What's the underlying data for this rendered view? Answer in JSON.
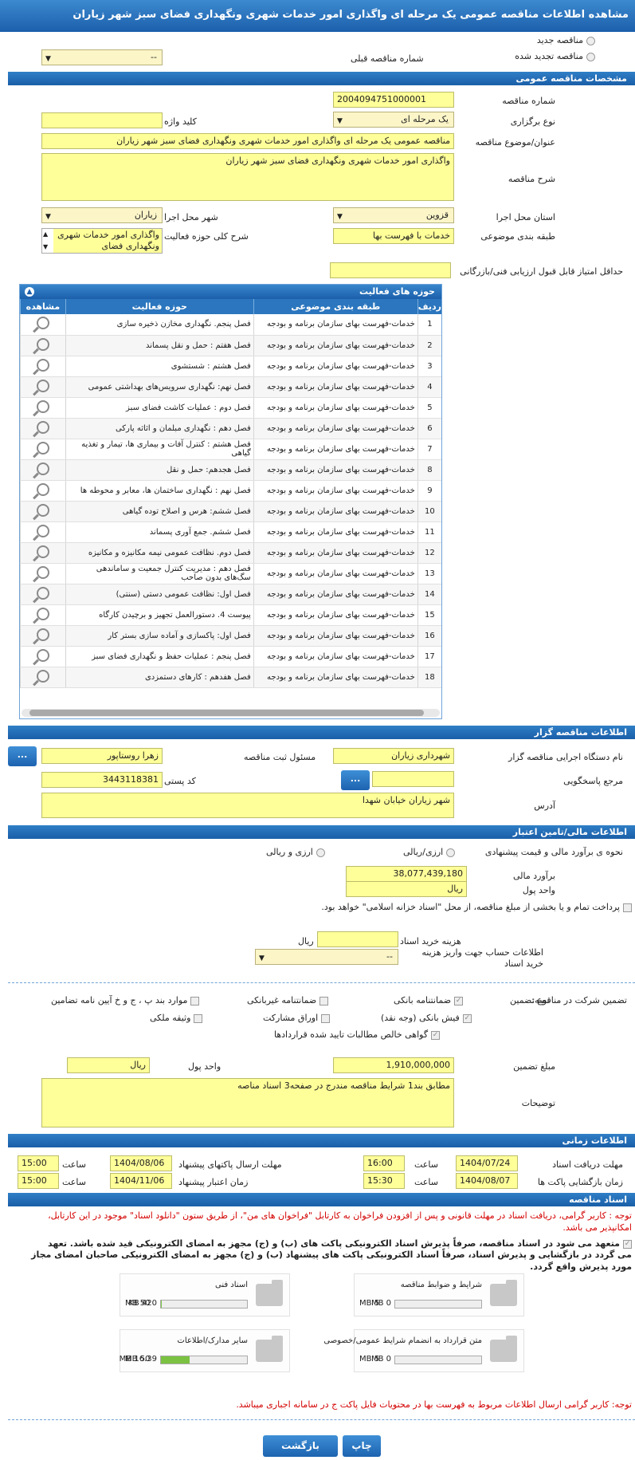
{
  "header": {
    "title": "مشاهده اطلاعات مناقصه عمومی یک مرحله ای واگذاری امور خدمات شهری ونگهداری فضای سبز شهر زیاران"
  },
  "top": {
    "new_tender": "مناقصه جدید",
    "renewed_tender": "مناقصه تجدید شده",
    "prev_number_label": "شماره مناقصه قبلی",
    "prev_number_value": "--"
  },
  "general": {
    "title": "مشخصات مناقصه عمومی",
    "number_label": "شماره مناقصه",
    "number_value": "2004094751000001",
    "type_label": "نوع برگزاری",
    "type_value": "یک مرحله ای",
    "keyword_label": "کلید واژه",
    "subject_label": "عنوان/موضوع مناقصه",
    "subject_value": "مناقصه عمومی یک مرحله ای واگذاری امور خدمات شهری ونگهداری فضای سبز شهر زیاران",
    "desc_label": "شرح مناقصه",
    "desc_value": "واگذاری امور خدمات شهری ونگهداری فضای سبز شهر زیاران",
    "province_label": "استان محل اجرا",
    "province_value": "قزوین",
    "city_label": "شهر محل اجرا",
    "city_value": "زیاران",
    "category_label": "طبقه بندی موضوعی",
    "category_value": "خدمات با فهرست بها",
    "activity_label": "شرح کلی حوزه فعالیت",
    "activity_value": "واگذاری امور خدمات شهری ونگهداری فضای",
    "min_score_label": "حداقل امتیاز قابل قبول ارزیابی فنی/بازرگانی"
  },
  "activities": {
    "title": "حوزه های فعالیت",
    "col_row": "ردیف",
    "col_cat": "طبقه بندی موضوعی",
    "col_area": "حوزه فعالیت",
    "col_view": "مشاهده",
    "cat_text": "خدمات-فهرست بهای سازمان برنامه و بودجه",
    "rows": [
      {
        "n": "1",
        "area": "فصل پنجم. نگهداری مخازن ذخیره سازی"
      },
      {
        "n": "2",
        "area": "فصل هفتم : حمل و نقل پسماند"
      },
      {
        "n": "3",
        "area": "فصل هشتم : شستشوی"
      },
      {
        "n": "4",
        "area": "فصل نهم: نگهداری سرویس‌های بهداشتی عمومی"
      },
      {
        "n": "5",
        "area": "فصل دوم : عملیات کاشت فضای سبز"
      },
      {
        "n": "6",
        "area": "فصل دهم : نگهداری مبلمان و اثاثه پارکی"
      },
      {
        "n": "7",
        "area": "فصل هشتم : کنترل آفات و بیماری ها، تیمار و تغذیه گیاهی"
      },
      {
        "n": "8",
        "area": "فصل هجدهم: حمل و نقل"
      },
      {
        "n": "9",
        "area": "فصل نهم : نگهداری ساختمان ها، معابر و محوطه ها"
      },
      {
        "n": "10",
        "area": "فصل ششم: هرس و اصلاح توده گیاهی"
      },
      {
        "n": "11",
        "area": "فصل ششم. جمع آوری پسماند"
      },
      {
        "n": "12",
        "area": "فصل دوم. نظافت عمومی نیمه مکانیزه و مکانیزه"
      },
      {
        "n": "13",
        "area": "فصل دهم : مدیریت کنترل جمعیت و ساماندهی سگ‌های بدون صاحب"
      },
      {
        "n": "14",
        "area": "فصل اول: نظافت عمومی دستی (سنتی)"
      },
      {
        "n": "15",
        "area": "پیوست 4. دستورالعمل تجهیز و برچیدن کارگاه"
      },
      {
        "n": "16",
        "area": "فصل اول:  پاکسازی و آماده سازی بستر کار"
      },
      {
        "n": "17",
        "area": "فصل پنجم : عملیات حفظ و نگهداری فضای سبز"
      },
      {
        "n": "18",
        "area": "فصل هفدهم : کارهای دستمزدی"
      }
    ]
  },
  "organizer": {
    "title": "اطلاعات مناقصه گزار",
    "org_label": "نام دستگاه اجرایی مناقصه گزار",
    "org_value": "شهرداری زیاران",
    "resp_label": "مسئول ثبت مناقصه",
    "resp_value": "زهرا روستاپور",
    "ref_label": "مرجع پاسخگویی",
    "postal_label": "کد پستی",
    "postal_value": "3443118381",
    "addr_label": "آدرس",
    "addr_value": "شهر زیاران خیابان شهدا",
    "dots": "..."
  },
  "finance": {
    "title": "اطلاعات مالی/تامین اعتبار",
    "method_label": "نحوه ی برآورد مالی و قیمت پیشنهادی",
    "opt1": "ارزی/ریالی",
    "opt2": "ارزی و ریالی",
    "estimate_label": "برآورد مالی",
    "estimate_value": "38,077,439,180",
    "currency_label": "واحد پول",
    "currency_value": "ریال",
    "treasury_text": "پرداخت تمام و یا بخشی از مبلغ مناقصه، از محل \"اسناد خزانه اسلامی\" خواهد بود.",
    "doc_fee_label": "هزینه خرید اسناد",
    "doc_fee_unit": "ریال",
    "account_label": "اطلاعات حساب جهت واریز هزینه خرید اسناد",
    "account_value": "--"
  },
  "guarantee": {
    "label": "تضمین شرکت در مناقصه:",
    "type_label": "نوع تضمین",
    "o1": "ضمانتنامه بانکی",
    "o2": "ضمانتنامه غیربانکی",
    "o3": "موارد بند پ ، ج و خ آیین نامه تضامین",
    "o4": "فیش بانکی (وجه نقد)",
    "o5": "اوراق مشارکت",
    "o6": "وثیقه ملکی",
    "o7": "گواهی خالص مطالبات تایید شده قراردادها",
    "amount_label": "مبلغ تضمین",
    "amount_value": "1,910,000,000",
    "cur_label": "واحد پول",
    "cur_value": "ریال",
    "notes_label": "توضیحات",
    "notes_value": "مطابق بند1 شرایط مناقصه مندرج در صفحه3 اسناد مناصه"
  },
  "timing": {
    "title": "اطلاعات زمانی",
    "recv_label": "مهلت دریافت اسناد",
    "recv_date": "1404/07/24",
    "recv_time": "16:00",
    "send_label": "مهلت ارسال پاکتهای پیشنهاد",
    "send_date": "1404/08/06",
    "send_time": "15:00",
    "open_label": "زمان بازگشایی پاکت ها",
    "open_date": "1404/08/07",
    "open_time": "15:30",
    "valid_label": "زمان اعتبار پیشنهاد",
    "valid_date": "1404/11/06",
    "valid_time": "15:00",
    "time_label": "ساعت"
  },
  "documents": {
    "title": "اسناد مناقصه",
    "note1a": "توجه : کاربر گرامی، دریافت اسناد در مهلت قانونی و پس از افزودن فراخوان به کارتابل \"فراخوان های من\"، از طریق ستون \"دانلود اسناد\" موجود در این کارتابل،",
    "note1b": "امکانپذیر می باشد.",
    "commit1": "متعهد می شود در اسناد مناقصه، صرفاً پذیرش اسناد الکترونیکی پاکت های (ب) و (ج) مجهز به امضای الکترونیکی قید شده باشد. تعهد",
    "commit2": "می گردد در بازگشایی و پذیرش اسناد، صرفاً اسناد الکترونیکی پاکت های پیشنهاد (ب) و (ج) مجهز به امضای الکترونیکی صاحبان امضای مجاز",
    "commit3": "مورد پذیرش واقع گردد.",
    "d1": {
      "title": "شرایط و ضوابط مناقصه",
      "used": "0 MB",
      "max": "5 MB",
      "fill": 0
    },
    "d2": {
      "title": "اسناد فنی",
      "used": "420 KB",
      "max": "50 MB",
      "fill": 0.01
    },
    "d3": {
      "title": "متن قرارداد به انضمام شرایط عمومی/خصوصی",
      "used": "0 MB",
      "max": "5 MB",
      "fill": 0
    },
    "d4": {
      "title": "سایر مدارک/اطلاعات",
      "used": "16.39 MB",
      "max": "50 MB",
      "fill": 0.33
    },
    "note2": "توجه: کاربر گرامی ارسال اطلاعات مربوط به فهرست بها در محتویات فایل پاکت ج در سامانه اجباری میباشد."
  },
  "buttons": {
    "print": "چاپ",
    "back": "بازگشت"
  }
}
